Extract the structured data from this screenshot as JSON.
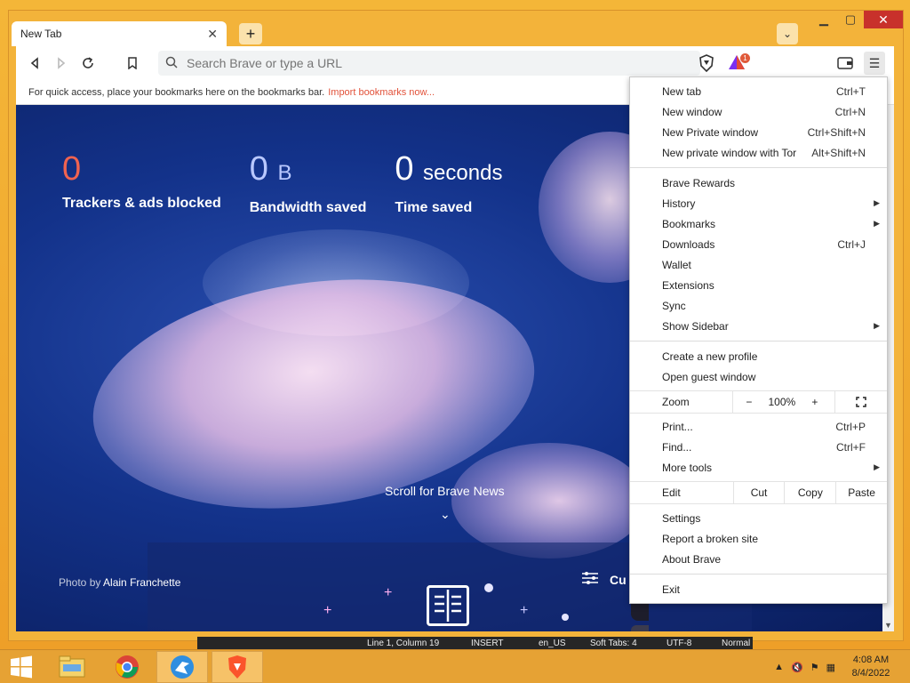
{
  "browser": {
    "tab_title": "New Tab",
    "omnibox_placeholder": "Search Brave or type a URL",
    "rewards_badge": "1",
    "bookmarks_bar_text": "For quick access, place your bookmarks here on the bookmarks bar.",
    "bookmarks_import_link": "Import bookmarks now..."
  },
  "new_tab_page": {
    "stats": {
      "trackers_value": "0",
      "trackers_label": "Trackers & ads blocked",
      "bandwidth_value": "0",
      "bandwidth_unit": "B",
      "bandwidth_label": "Bandwidth saved",
      "time_value": "0",
      "time_unit": "seconds",
      "time_label": "Time saved"
    },
    "scroll_news": "Scroll for Brave News",
    "photo_by": "Photo by",
    "photo_author": "Alain Franchette",
    "customize_label": "Cu"
  },
  "menu": {
    "group1": [
      {
        "label": "New tab",
        "shortcut": "Ctrl+T"
      },
      {
        "label": "New window",
        "shortcut": "Ctrl+N"
      },
      {
        "label": "New Private window",
        "shortcut": "Ctrl+Shift+N"
      },
      {
        "label": "New private window with Tor",
        "shortcut": "Alt+Shift+N"
      }
    ],
    "group2": [
      {
        "label": "Brave Rewards",
        "shortcut": ""
      },
      {
        "label": "History",
        "shortcut": "",
        "submenu": true
      },
      {
        "label": "Bookmarks",
        "shortcut": "",
        "submenu": true
      },
      {
        "label": "Downloads",
        "shortcut": "Ctrl+J"
      },
      {
        "label": "Wallet",
        "shortcut": ""
      },
      {
        "label": "Extensions",
        "shortcut": ""
      },
      {
        "label": "Sync",
        "shortcut": ""
      },
      {
        "label": "Show Sidebar",
        "shortcut": "",
        "submenu": true
      }
    ],
    "group3": [
      {
        "label": "Create a new profile"
      },
      {
        "label": "Open guest window"
      }
    ],
    "zoom": {
      "label": "Zoom",
      "minus": "−",
      "value": "100%",
      "plus": "+"
    },
    "group4": [
      {
        "label": "Print...",
        "shortcut": "Ctrl+P"
      },
      {
        "label": "Find...",
        "shortcut": "Ctrl+F"
      },
      {
        "label": "More tools",
        "shortcut": "",
        "submenu": true
      }
    ],
    "edit": {
      "label": "Edit",
      "cut": "Cut",
      "copy": "Copy",
      "paste": "Paste"
    },
    "group5": [
      {
        "label": "Settings"
      },
      {
        "label": "Report a broken site"
      },
      {
        "label": "About Brave"
      }
    ],
    "exit": "Exit"
  },
  "editor_status": {
    "position": "Line 1, Column 19",
    "mode": "INSERT",
    "lang": "en_US",
    "tabs": "Soft Tabs: 4",
    "encoding": "UTF-8",
    "state": "Normal"
  },
  "taskbar": {
    "time": "4:08 AM",
    "date": "8/4/2022"
  },
  "colors": {
    "accent": "#e2523a",
    "desktop": "#f0a830",
    "page_bg": "#13328a"
  }
}
